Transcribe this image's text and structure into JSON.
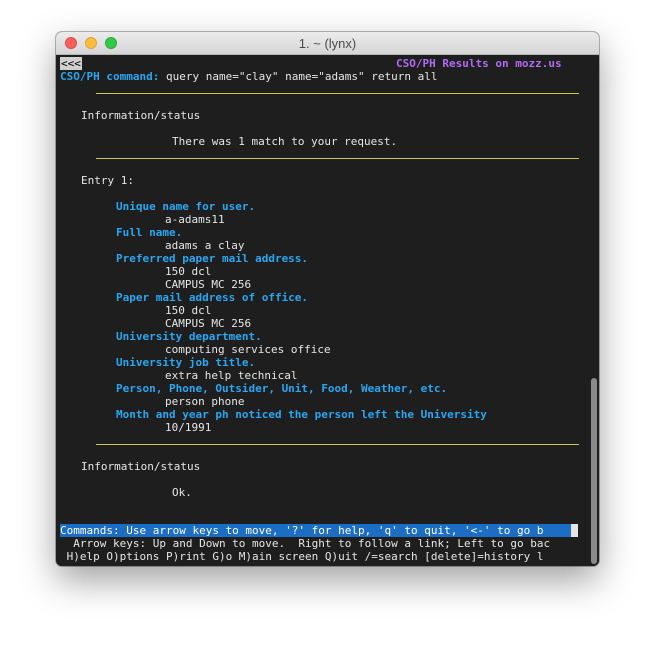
{
  "window": {
    "title": "1. ~ (lynx)"
  },
  "header": {
    "back_link": "<<<",
    "page_title": "CSO/PH Results on mozz.us",
    "command_label": "CSO/PH command:",
    "command_text": " query name=\"clay\" name=\"adams\" return all"
  },
  "info1": {
    "heading": "Information/status",
    "message": "There was 1 match to your request."
  },
  "entry": {
    "heading": "Entry 1:",
    "fields": [
      {
        "label": "Unique name for user.",
        "values": [
          "a-adams11"
        ]
      },
      {
        "label": "Full name.",
        "values": [
          "adams a clay"
        ]
      },
      {
        "label": "Preferred paper mail address.",
        "values": [
          "150 dcl",
          "CAMPUS MC 256"
        ]
      },
      {
        "label": "Paper mail address of office.",
        "values": [
          "150 dcl",
          "CAMPUS MC 256"
        ]
      },
      {
        "label": "University department.",
        "values": [
          "computing services office"
        ]
      },
      {
        "label": "University job title.",
        "values": [
          "extra help technical"
        ]
      },
      {
        "label": "Person, Phone, Outsider, Unit, Food, Weather, etc.",
        "values": [
          "person phone"
        ]
      },
      {
        "label": "Month and year ph noticed the person left the University",
        "values": [
          "10/1991"
        ]
      }
    ]
  },
  "info2": {
    "heading": "Information/status",
    "message": "Ok."
  },
  "status": {
    "commands": "Commands: Use arrow keys to move, '?' for help, 'q' to quit, '<-' to go b",
    "arrows": "  Arrow keys: Up and Down to move.  Right to follow a link; Left to go bac",
    "keys": " H)elp O)ptions P)rint G)o M)ain screen Q)uit /=search [delete]=history l"
  },
  "colors": {
    "link": "#2aa7f2",
    "title": "#b06cf2",
    "rule": "#d4c24a",
    "status_bar": "#1c6ec5"
  }
}
